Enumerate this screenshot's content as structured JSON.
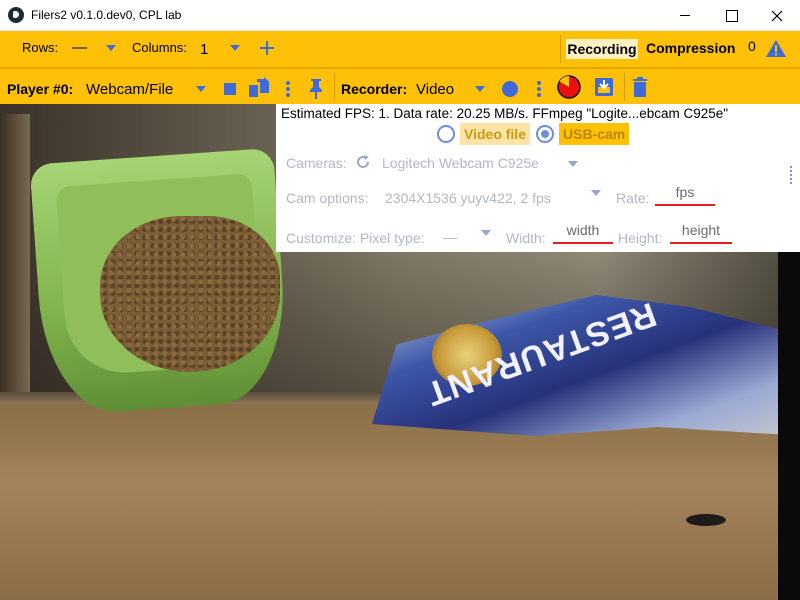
{
  "window": {
    "title": "Filers2 v0.1.0.dev0, CPL lab",
    "icon": "kivy-app-icon"
  },
  "toolbar1": {
    "rows_label": "Rows:",
    "rows_value": "—",
    "columns_label": "Columns:",
    "columns_value": "1",
    "add_icon": "plus-icon",
    "recording_label": "Recording",
    "compression_label": "Compression",
    "warning_count": "0",
    "warning_icon": "warning-triangle-icon"
  },
  "toolbar2": {
    "player_label": "Player #0:",
    "player_value": "Webcam/File",
    "recorder_label": "Recorder:",
    "recorder_value": "Video"
  },
  "settings": {
    "status": "Estimated FPS: 1. Data rate: 20.25 MB/s. FFmpeg \"Logite...ebcam C925e\"",
    "source_options": [
      {
        "label": "Video file",
        "selected": false
      },
      {
        "label": "USB-cam",
        "selected": true
      }
    ],
    "cameras_label": "Cameras:",
    "camera_value": "Logitech Webcam C925e",
    "cam_options_label": "Cam options:",
    "cam_options_value": "2304X1536 yuyv422, 2 fps",
    "rate_label": "Rate:",
    "rate_placeholder": "fps",
    "customize_label": "Customize: Pixel type:",
    "pixel_type_value": "—",
    "width_label": "Width:",
    "width_placeholder": "width",
    "height_label": "Height:",
    "height_placeholder": "height"
  },
  "camera_feed": {
    "bag_text": "RESTAURANT"
  },
  "colors": {
    "toolbar": "#ffc107",
    "accent_blue": "#3f6ad8",
    "record_red": "#e81010"
  }
}
